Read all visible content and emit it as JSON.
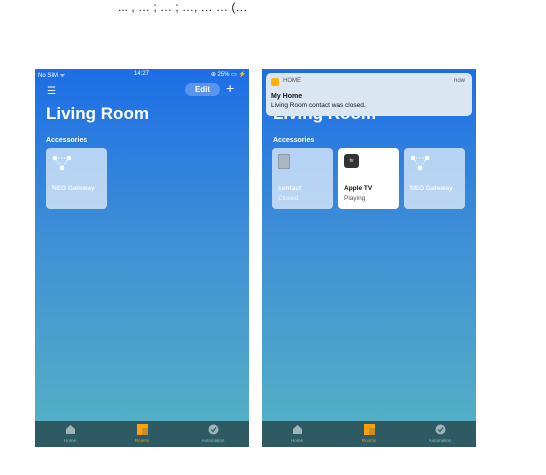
{
  "top_text": "... , … ; … ; …, … … (…",
  "left": {
    "status": {
      "carrier": "No SIM ᯤ",
      "time": "14:27",
      "battery": "⊕ 25% ▭ ⚡"
    },
    "edit_label": "Edit",
    "plus_label": "+",
    "room_title": "Living Room",
    "section": "Accessories",
    "tiles": [
      {
        "name": "NEO Gateway",
        "icon": "gateway-icon"
      }
    ],
    "tabs": [
      {
        "label": "Home",
        "icon": "home-icon"
      },
      {
        "label": "Rooms",
        "icon": "rooms-icon"
      },
      {
        "label": "Automation",
        "icon": "automation-icon"
      }
    ]
  },
  "right": {
    "notification": {
      "app": "HOME",
      "when": "now",
      "title": "My Home",
      "body": "Living Room contact was closed."
    },
    "room_title": "Living Room",
    "section": "Accessories",
    "tiles": [
      {
        "name": "contact",
        "status": "Closed",
        "icon": "door-icon"
      },
      {
        "name": "Apple TV",
        "status": "Playing",
        "icon": "apple-tv-icon",
        "icon_text": "tv"
      },
      {
        "name": "NEO Gateway",
        "status": "",
        "icon": "gateway-icon"
      }
    ],
    "tabs": [
      {
        "label": "Home",
        "icon": "home-icon"
      },
      {
        "label": "Rooms",
        "icon": "rooms-icon"
      },
      {
        "label": "Automation",
        "icon": "automation-icon"
      }
    ]
  },
  "colors": {
    "accent": "#ff9f0a",
    "tabbar": "#2e5b63",
    "gradient_top": "#1d6ee6",
    "gradient_bottom": "#56b3c3"
  }
}
